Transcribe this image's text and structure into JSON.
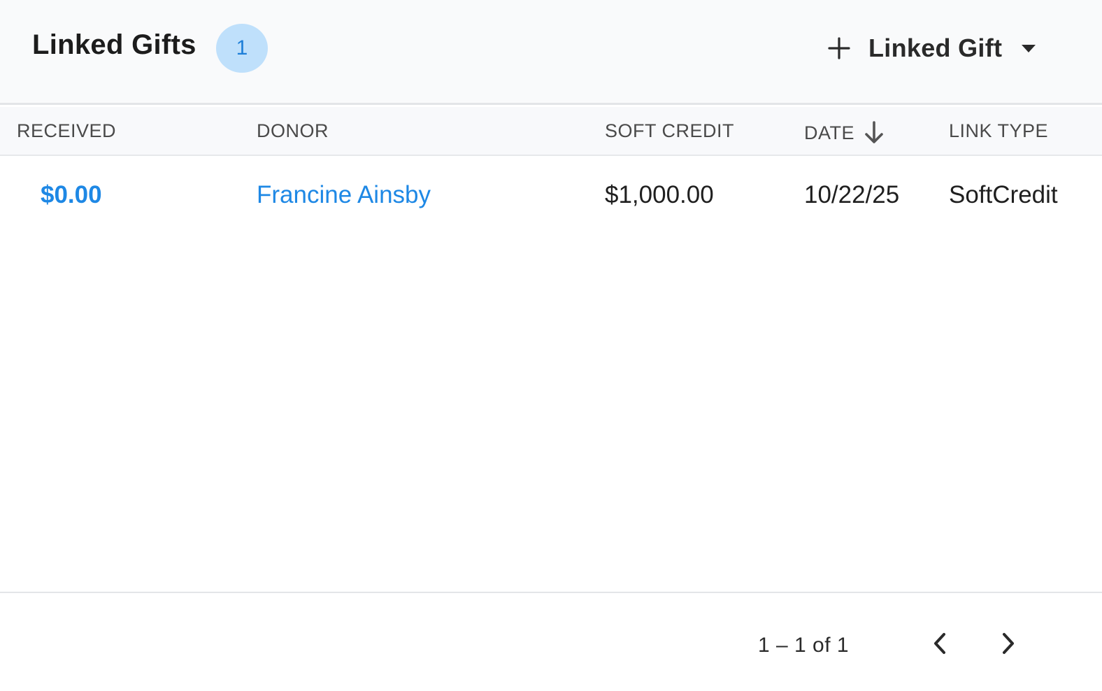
{
  "header": {
    "title": "Linked Gifts",
    "count": "1",
    "add_button_label": "Linked Gift"
  },
  "table": {
    "columns": [
      "RECEIVED",
      "DONOR",
      "SOFT CREDIT",
      "DATE",
      "LINK TYPE"
    ],
    "sort_column": "DATE",
    "sort_direction": "descending",
    "rows": [
      {
        "received": "$0.00",
        "donor": "Francine Ainsby",
        "soft_credit": "$1,000.00",
        "date": "10/22/25",
        "link_type": "SoftCredit"
      }
    ]
  },
  "pagination": {
    "range_text": "1 – 1 of 1"
  },
  "icons": {
    "add": "plus-icon",
    "menu": "caret-down-icon",
    "sort": "arrow-down-icon",
    "prev": "chevron-left-icon",
    "next": "chevron-right-icon"
  },
  "colors": {
    "link": "#1e88e5",
    "badge_bg": "#bfe0fb",
    "badge_text": "#1e7fd8",
    "header_bg": "#f9fafb"
  }
}
